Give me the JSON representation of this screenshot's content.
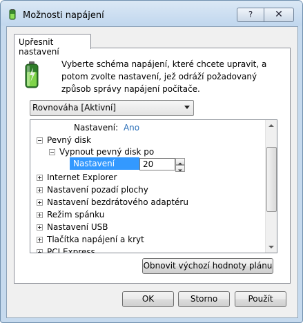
{
  "window": {
    "title": "Možnosti napájení",
    "help_glyph": "?",
    "close_glyph": "✕"
  },
  "tab": {
    "label": "Upřesnit nastavení"
  },
  "description": "Vyberte schéma napájení, které chcete upravit, a potom zvolte nastavení, jež odráží požadovaný způsob správy napájení počítače.",
  "scheme_select": {
    "value": "Rovnováha [Aktivní]"
  },
  "tree": {
    "setting_label": "Nastavení:",
    "setting_value": "Ano",
    "disk": "Pevný disk",
    "disk_off": "Vypnout pevný disk po",
    "minutes_label": "Nastavení (min.):",
    "minutes_value": "20",
    "items": [
      "Internet Explorer",
      "Nastavení pozadí plochy",
      "Nastavení bezdrátového adaptéru",
      "Režim spánku",
      "Nastavení USB",
      "Tlačítka napájení a kryt",
      "PCI Express"
    ]
  },
  "buttons": {
    "restore": "Obnovit výchozí hodnoty plánu",
    "ok": "OK",
    "cancel": "Storno",
    "apply": "Použít"
  },
  "colors": {
    "highlight": "#3399ff",
    "link_value": "#2a6fb8"
  }
}
